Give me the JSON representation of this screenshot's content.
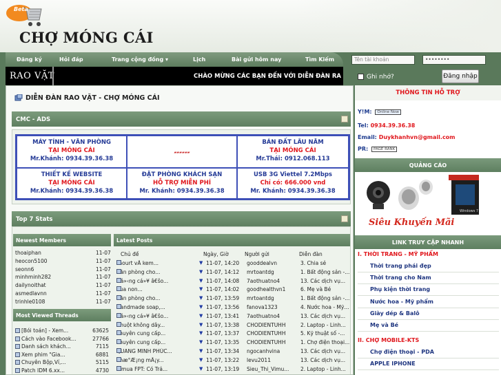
{
  "site": {
    "beta": "Beta",
    "title": "CHỢ MÓNG CÁI"
  },
  "nav": {
    "items": [
      "Đăng ký",
      "Hỏi đáp",
      "Trang cộng đồng",
      "Lịch",
      "Bài gửi hôm nay",
      "Tìm Kiếm"
    ]
  },
  "login": {
    "username_placeholder": "Tên tài khoản",
    "password_value": "••••••••",
    "remember_label": "Ghi nhớ?",
    "button_label": "Đăng nhập"
  },
  "adbar": {
    "label": "RAO VẶT",
    "marquee": "CHÀO MỪNG CÁC BẠN ĐẾN VỚI DIỄN ĐÀN RA"
  },
  "breadcrumb": "DIỄN ĐÀN RAO VẶT - CHỢ MÓNG CÁI",
  "ads": {
    "title": "CMC - ADS",
    "cells": [
      {
        "l1": "MÁY TÍNH - VĂN PHÒNG",
        "l2": "TẠI MÓNG CÁI",
        "l3": "Mr.Khánh: 0934.39.36.38"
      },
      {
        "l1": "",
        "l2": "",
        "l3": ""
      },
      {
        "l1": "BÁN ĐẤT LÂU NĂM",
        "l2": "TẠI MÓNG CÁI",
        "l3": "Mr.Thái: 0912.068.113"
      },
      {
        "l1": "THIẾT KẾ WEBSITE",
        "l2": "TẠI MÓNG CÁI",
        "l3": "Mr.Khánh: 0934.39.36.38"
      },
      {
        "l1": "ĐẶT PHÒNG KHÁCH SẠN",
        "l2": "HỖ TRỢ MIỄN PHÍ",
        "l3": "Mr. Khánh: 0934.39.36.38"
      },
      {
        "l1": "USB 3G Viettel 7.2Mbps",
        "l2": "Chỉ có: 666.000 vnd",
        "l3": "Mr. Khánh: 0934.39.36.38"
      }
    ]
  },
  "stats": {
    "title": "Top 7 Stats",
    "newest_members_title": "Newest Members",
    "members": [
      {
        "name": "thoaiphan",
        "date": "11-07"
      },
      {
        "name": "heocon5100",
        "date": "11-07"
      },
      {
        "name": "seonn6",
        "date": "11-07"
      },
      {
        "name": "minhminh282",
        "date": "11-07"
      },
      {
        "name": "dailynoithat",
        "date": "11-07"
      },
      {
        "name": "asmedlavnn",
        "date": "11-07"
      },
      {
        "name": "trinhle0108",
        "date": "11-07"
      }
    ],
    "most_viewed_title": "Most Viewed Threads",
    "threads": [
      {
        "title": "[Bói toán] - Xem...",
        "views": "63625"
      },
      {
        "title": "Cách vào Facebook...",
        "views": "27766"
      },
      {
        "title": "Danh sách khách...",
        "views": "7115"
      },
      {
        "title": "Xem phim \"Gia...",
        "views": "6881"
      },
      {
        "title": "Chuyên Bộp,Ví,...",
        "views": "5115"
      },
      {
        "title": "Patch IDM 6.xx...",
        "views": "4730"
      }
    ],
    "latest_posts_title": "Latest Posts",
    "post_headers": {
      "subject": "Chủ đề",
      "date": "Ngày, Giờ",
      "poster": "Người gửi",
      "forum": "Diễn đàn"
    },
    "posts": [
      {
        "subject": "Yaourt vÃ  kem...",
        "date": "11-07, 14:20",
        "poster": "gooddealvn",
        "forum": "3. Chia sẻ"
      },
      {
        "subject": "Văn phòng cho...",
        "date": "11-07, 14:12",
        "poster": "mrtoantdg",
        "forum": "1. Bất động sản -..."
      },
      {
        "subject": "Dá»‹ng cá»¥ â€šo...",
        "date": "11-07, 14:08",
        "poster": "7aothuatno4",
        "forum": "13. Các dịch vụ..."
      },
      {
        "subject": "Sua non...",
        "date": "11-07, 14:02",
        "poster": "goodhealthvn1",
        "forum": "6. Mẹ và Bé"
      },
      {
        "subject": "Văn phòng cho...",
        "date": "11-07, 13:59",
        "poster": "mrtoantdg",
        "forum": "1. Bất động sản -..."
      },
      {
        "subject": "Handmade soap,...",
        "date": "11-07, 13:56",
        "poster": "fanova1323",
        "forum": "4. Nước hoa - Mỹ..."
      },
      {
        "subject": "Dá»‹ng cá»¥ â€šo...",
        "date": "11-07, 13:41",
        "poster": "7aothuatno4",
        "forum": "13. Các dịch vụ..."
      },
      {
        "subject": "Chuột không dây...",
        "date": "11-07, 13:38",
        "poster": "CHODIENTUHH",
        "forum": "2. Laptop - Linh..."
      },
      {
        "subject": "chuyên cung cấp...",
        "date": "11-07, 13:37",
        "poster": "CHODIENTUHH",
        "forum": "5. Kỹ thuật số -..."
      },
      {
        "subject": "chuyên cung cấp...",
        "date": "11-07, 13:35",
        "poster": "CHODIENTUHH",
        "forum": "1. Chợ điện thoại..."
      },
      {
        "subject": "QUANG MINH PHÚC...",
        "date": "11-07, 13:34",
        "poster": "ngocanhvina",
        "forum": "13. Các dịch vụ..."
      },
      {
        "subject": "Phæ°Æ¡ng mÃ¡y...",
        "date": "11-07, 13:22",
        "poster": "levu2011",
        "forum": "13. Các dịch vụ..."
      },
      {
        "subject": "Vimua FPT: Có Trả...",
        "date": "11-07, 13:19",
        "poster": "Sieu_Thi_Vimu...",
        "forum": "2. Laptop - Linh..."
      }
    ]
  },
  "support": {
    "title": "THÔNG TIN HỖ TRỢ",
    "yim_label": "Y!M:",
    "yim_badge": "Online Now",
    "tel_label": "Tel:",
    "tel": "0934.39.36.38",
    "email_label": "Email:",
    "email": "Duykhanhvn@gmail.com",
    "pr_label": "PR:",
    "pr_badge": "PAGE RANK"
  },
  "ad_section": {
    "title": "QUẢNG CÁO",
    "banner_text": "Siêu Khuyến Mãi"
  },
  "quick_links": {
    "title": "LINK TRUY CẬP NHANH",
    "cat1": "I. THỜI TRANG - MỸ PHẨM",
    "cat1_items": [
      "Thời trang phái đẹp",
      "Thời trang cho Nam",
      "Phụ kiện thời trang",
      "Nước hoa - Mỹ phẩm",
      "Giày dép & Balô",
      "Mẹ và Bé"
    ],
    "cat2": "II. CHỢ MOBILE-KTS",
    "cat2_items": [
      "Chợ điện thoại - PDA",
      "APPLE IPHONE"
    ]
  },
  "colors": {
    "nav_green": "#6a8a6b",
    "border_green": "#5a7a5c",
    "ad_blue": "#243a96",
    "ad_red": "#e0161c"
  }
}
